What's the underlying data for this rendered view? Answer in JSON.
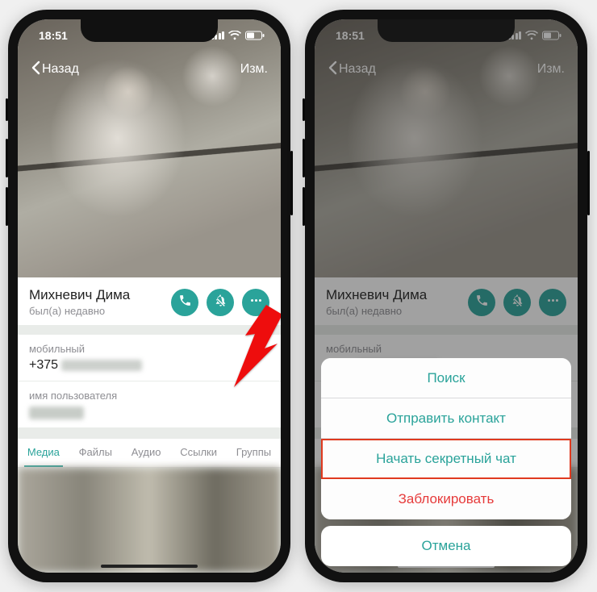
{
  "status": {
    "time": "18:51"
  },
  "nav": {
    "back": "Назад",
    "edit": "Изм."
  },
  "contact": {
    "name": "Михневич Дима",
    "status": "был(а) недавно",
    "phone_label": "мобильный",
    "phone_prefix": "+375",
    "username_label": "имя пользователя"
  },
  "tabs": {
    "media": "Медиа",
    "files": "Файлы",
    "audio": "Аудио",
    "links": "Ссылки",
    "groups": "Группы"
  },
  "sheet": {
    "search": "Поиск",
    "send_contact": "Отправить контакт",
    "secret_chat": "Начать секретный чат",
    "block": "Заблокировать",
    "cancel": "Отмена"
  },
  "colors": {
    "accent": "#2aa39a",
    "destructive": "#e63b3b"
  }
}
